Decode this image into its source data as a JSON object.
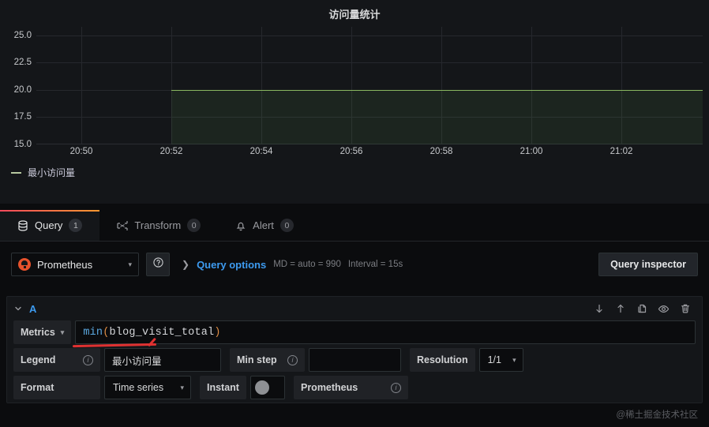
{
  "panel": {
    "title": "访问量统计",
    "legend_series": "最小访问量"
  },
  "chart_data": {
    "type": "line",
    "title": "访问量统计",
    "xlabel": "",
    "ylabel": "",
    "series": [
      {
        "name": "最小访问量",
        "color": "#8ab860",
        "x": [
          "20:52",
          "20:54",
          "20:56",
          "20:58",
          "21:00",
          "21:02",
          "21:03"
        ],
        "values": [
          20,
          20,
          20,
          20,
          20,
          20,
          20
        ]
      }
    ],
    "x_ticks": [
      "20:50",
      "20:52",
      "20:54",
      "20:56",
      "20:58",
      "21:00",
      "21:02"
    ],
    "y_ticks": [
      "25.0",
      "22.5",
      "20.0",
      "17.5",
      "15.0"
    ],
    "ylim": [
      15.0,
      25.0
    ],
    "grid": true,
    "legend_position": "bottom-left",
    "fill": true
  },
  "tabs": [
    {
      "label": "Query",
      "badge": "1",
      "icon": "database-icon",
      "active": true
    },
    {
      "label": "Transform",
      "badge": "0",
      "icon": "transform-icon",
      "active": false
    },
    {
      "label": "Alert",
      "badge": "0",
      "icon": "bell-icon",
      "active": false
    }
  ],
  "datasource": {
    "name": "Prometheus",
    "help_icon": "help-circle-icon",
    "query_options_label": "Query options",
    "max_data_points": "MD = auto = 990",
    "interval": "Interval = 15s",
    "query_inspector_label": "Query inspector"
  },
  "query": {
    "ref_id": "A",
    "metrics_label": "Metrics",
    "expression_fn": "min",
    "expression_open": "(",
    "expression_arg": "blog_visit_total",
    "expression_close": ")",
    "legend_label": "Legend",
    "legend_value": "最小访问量",
    "min_step_label": "Min step",
    "min_step_value": "",
    "resolution_label": "Resolution",
    "resolution_value": "1/1",
    "format_label": "Format",
    "format_value": "Time series",
    "instant_label": "Instant",
    "instant_on": false,
    "exemplars_label": "Prometheus",
    "actions": [
      {
        "name": "move-query-down-icon"
      },
      {
        "name": "move-query-up-icon"
      },
      {
        "name": "duplicate-query-icon"
      },
      {
        "name": "toggle-query-visibility-icon"
      },
      {
        "name": "remove-query-icon"
      }
    ]
  },
  "watermark": "@稀土掘金技术社区",
  "colors": {
    "accent_blue": "#3d9bf0",
    "series_green": "#8ab860",
    "tab_active": "#ff9830",
    "annotation_red": "#e03131"
  }
}
